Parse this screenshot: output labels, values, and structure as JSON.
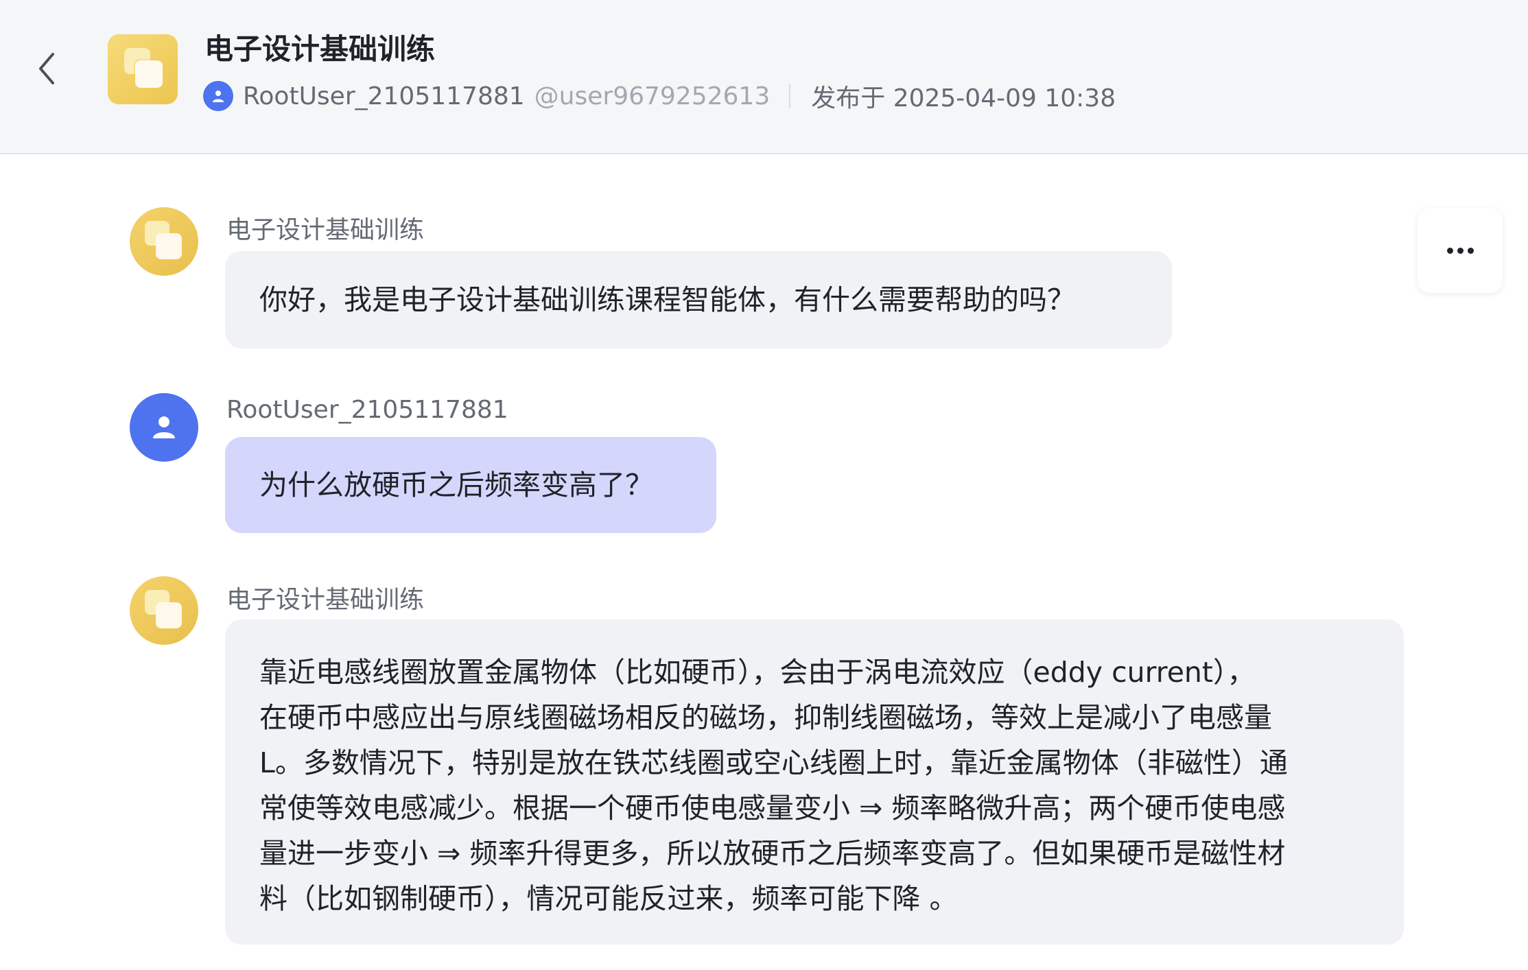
{
  "header": {
    "title": "电子设计基础训练",
    "author_name": "RootUser_2105117881",
    "author_handle": "@user9679252613",
    "published": "发布于 2025-04-09 10:38"
  },
  "messages": [
    {
      "role": "agent",
      "sender": "电子设计基础训练",
      "lines": [
        "你好，我是电子设计基础训练课程智能体，有什么需要帮助的吗？"
      ]
    },
    {
      "role": "user",
      "sender": "RootUser_2105117881",
      "lines": [
        "为什么放硬币之后频率变高了？"
      ]
    },
    {
      "role": "agent",
      "sender": "电子设计基础训练",
      "lines": [
        "靠近电感线圈放置金属物体（比如硬币），会由于涡电流效应（eddy current），",
        "在硬币中感应出与原线圈磁场相反的磁场，抑制线圈磁场，等效上是减小了电感量",
        "L。多数情况下，特别是放在铁芯线圈或空心线圈上时，靠近金属物体（非磁性）通",
        "常使等效电感减少。根据一个硬币使电感量变小 ⇒ 频率略微升高；两个硬币使电感",
        "量进一步变小 ⇒ 频率升得更多，所以放硬币之后频率变高了。但如果硬币是磁性材",
        "料（比如钢制硬币），情况可能反过来，频率可能下降 。"
      ]
    }
  ],
  "icons": {
    "back": "chevron-left-icon",
    "more": "more-horizontal-icon",
    "user": "person-icon",
    "agent": "agent-logo-icon"
  },
  "colors": {
    "user_bubble": "#d4d6fc",
    "agent_bubble": "#f1f2f5",
    "user_avatar": "#4e73ee",
    "agent_avatar": "#ecc54f"
  }
}
